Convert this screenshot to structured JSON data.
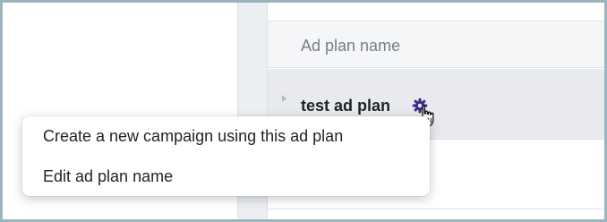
{
  "table": {
    "header_label": "Ad plan name",
    "rows": [
      {
        "name": "test ad plan",
        "icon": "gear-icon"
      }
    ]
  },
  "context_menu": {
    "items": [
      {
        "label": "Create a new campaign using this ad plan"
      },
      {
        "label": "Edit ad plan name"
      }
    ]
  },
  "colors": {
    "gear_accent": "#3d2a8c",
    "selected_row_bg": "#e8eaee",
    "header_bg": "#f5f6f8",
    "frame_border": "#9cb4bd"
  }
}
